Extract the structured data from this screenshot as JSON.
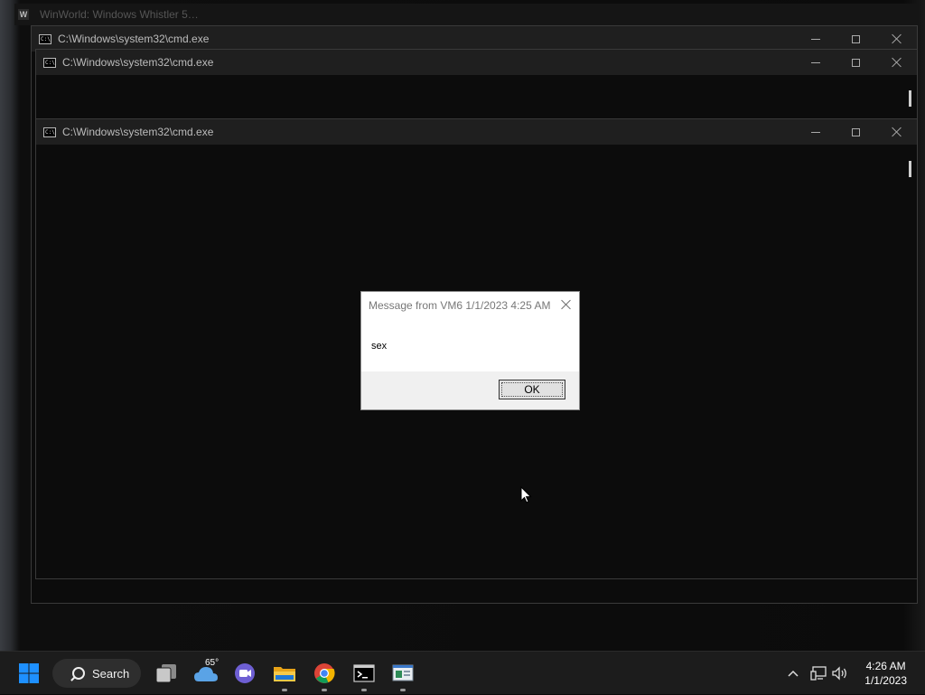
{
  "background_window": {
    "title": "WinWorld: Windows Whistler 5…"
  },
  "windows": [
    {
      "title": "C:\\Windows\\system32\\cmd.exe"
    },
    {
      "title": "C:\\Windows\\system32\\cmd.exe"
    },
    {
      "title": "C:\\Windows\\system32\\cmd.exe"
    }
  ],
  "cmd_icon_text": "C:\\",
  "dialog": {
    "title": "Message from VM6 1/1/2023 4:25 AM",
    "message": "sex",
    "ok_label": "OK"
  },
  "taskbar": {
    "search_label": "Search",
    "weather_temp": "65°",
    "apps": [
      "task-view-icon",
      "weather-icon",
      "chat-icon",
      "file-explorer-icon",
      "chrome-icon",
      "terminal-icon",
      "remote-app-icon"
    ]
  },
  "tray": {
    "time": "4:26 AM",
    "date": "1/1/2023"
  },
  "colors": {
    "taskbar_bg": "#1c1c1c",
    "titlebar_bg": "#1f1f1f",
    "console_bg": "#0c0c0c",
    "windows_blue": "#0a84ff"
  }
}
